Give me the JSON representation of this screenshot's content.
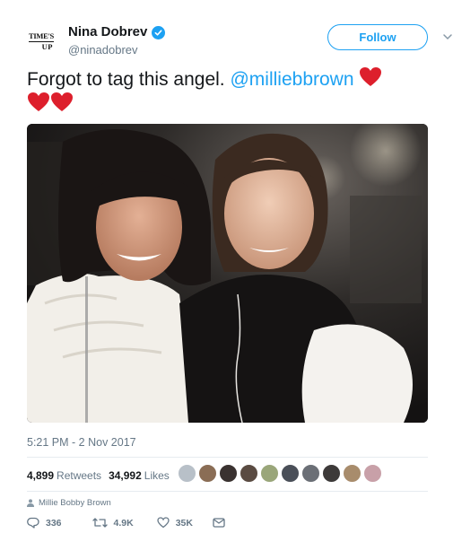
{
  "author": {
    "avatar_line1": "TIME'S",
    "avatar_line2": "UP",
    "display_name": "Nina Dobrev",
    "handle": "@ninadobrev"
  },
  "follow_label": "Follow",
  "tweet": {
    "text": "Forgot to tag this angel.",
    "mention": "@milliebbrown"
  },
  "timestamp": "5:21 PM - 2 Nov 2017",
  "stats": {
    "retweets_count": "4,899",
    "retweets_label": "Retweets",
    "likes_count": "34,992",
    "likes_label": "Likes"
  },
  "tagged_user": "Millie Bobby Brown",
  "actions": {
    "replies": "336",
    "retweets": "4.9K",
    "likes": "35K"
  },
  "colors": {
    "accent": "#1da1f2",
    "heart": "#e0245e",
    "secondary_text": "#657786",
    "divider": "#e6ecf0"
  },
  "liker_avatar_colors": [
    "#b8c0c8",
    "#8a6d55",
    "#3a3230",
    "#5a4b42",
    "#9aa67a",
    "#4a4f58",
    "#6b6f76",
    "#3d3a39",
    "#a88c6c",
    "#c8a0a8"
  ]
}
